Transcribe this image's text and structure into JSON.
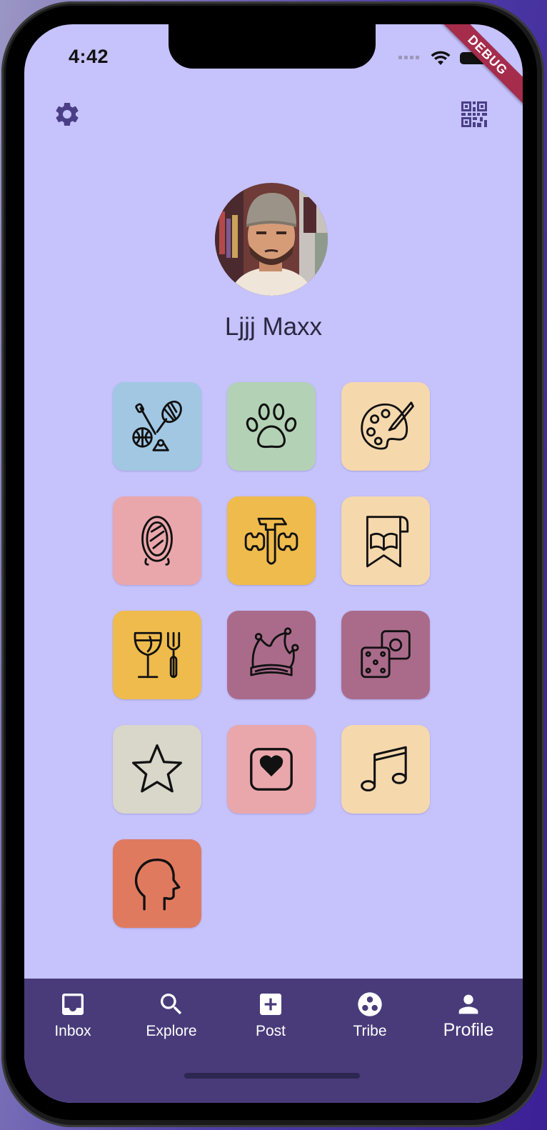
{
  "status_bar": {
    "time": "4:42"
  },
  "debug_banner": "DEBUG",
  "profile": {
    "name": "Ljjj Maxx"
  },
  "interests": [
    {
      "icon": "sports-icon",
      "color": "#a1c7e3"
    },
    {
      "icon": "paw-icon",
      "color": "#b3d2b5"
    },
    {
      "icon": "palette-icon",
      "color": "#f6d8ad"
    },
    {
      "icon": "mirror-icon",
      "color": "#eaa7ab"
    },
    {
      "icon": "tools-icon",
      "color": "#efbb4c"
    },
    {
      "icon": "book-icon",
      "color": "#f6d8ad"
    },
    {
      "icon": "dining-icon",
      "color": "#efbb4c"
    },
    {
      "icon": "jester-hat-icon",
      "color": "#aa6b8b"
    },
    {
      "icon": "dice-icon",
      "color": "#aa6b8b"
    },
    {
      "icon": "star-icon",
      "color": "#d9d6ca"
    },
    {
      "icon": "heart-box-icon",
      "color": "#eaa7ab"
    },
    {
      "icon": "music-note-icon",
      "color": "#f6d8ad"
    },
    {
      "icon": "head-profile-icon",
      "color": "#e07a5f"
    }
  ],
  "nav": {
    "items": [
      {
        "label": "Inbox",
        "icon": "inbox-icon"
      },
      {
        "label": "Explore",
        "icon": "search-icon"
      },
      {
        "label": "Post",
        "icon": "add-box-icon"
      },
      {
        "label": "Tribe",
        "icon": "tribe-icon"
      },
      {
        "label": "Profile",
        "icon": "person-icon"
      }
    ],
    "active": "Profile"
  },
  "colors": {
    "screen_bg": "#c5c2fc",
    "accent": "#493b7a",
    "icon_dark": "#4a3f87"
  }
}
